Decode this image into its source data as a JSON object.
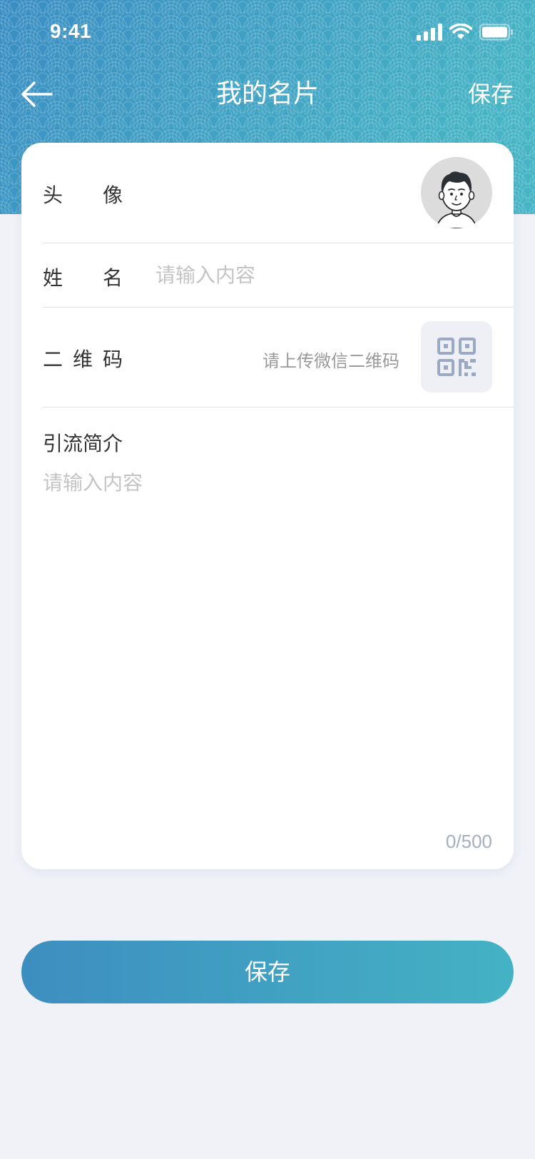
{
  "status_bar": {
    "time": "9:41"
  },
  "nav": {
    "back_icon": "arrow-left-icon",
    "title": "我的名片",
    "action_label": "保存"
  },
  "form": {
    "avatar": {
      "label_chars": [
        "头",
        "像"
      ],
      "icon": "avatar-cartoon-icon"
    },
    "name": {
      "label_chars": [
        "姓",
        "名"
      ],
      "value": "",
      "placeholder": "请输入内容"
    },
    "qrcode": {
      "label_chars": [
        "二",
        "维",
        "码"
      ],
      "hint": "请上传微信二维码",
      "icon": "qrcode-icon"
    },
    "intro": {
      "label": "引流简介",
      "value": "",
      "placeholder": "请输入内容",
      "counter": "0/500"
    }
  },
  "footer": {
    "save_label": "保存"
  },
  "colors": {
    "header_gradient_start": "#3a8fc4",
    "header_gradient_end": "#45b3c4",
    "background": "#f0f2f7",
    "card": "#ffffff",
    "placeholder": "#c4c4c4",
    "qr_icon": "#9aa9c4"
  }
}
